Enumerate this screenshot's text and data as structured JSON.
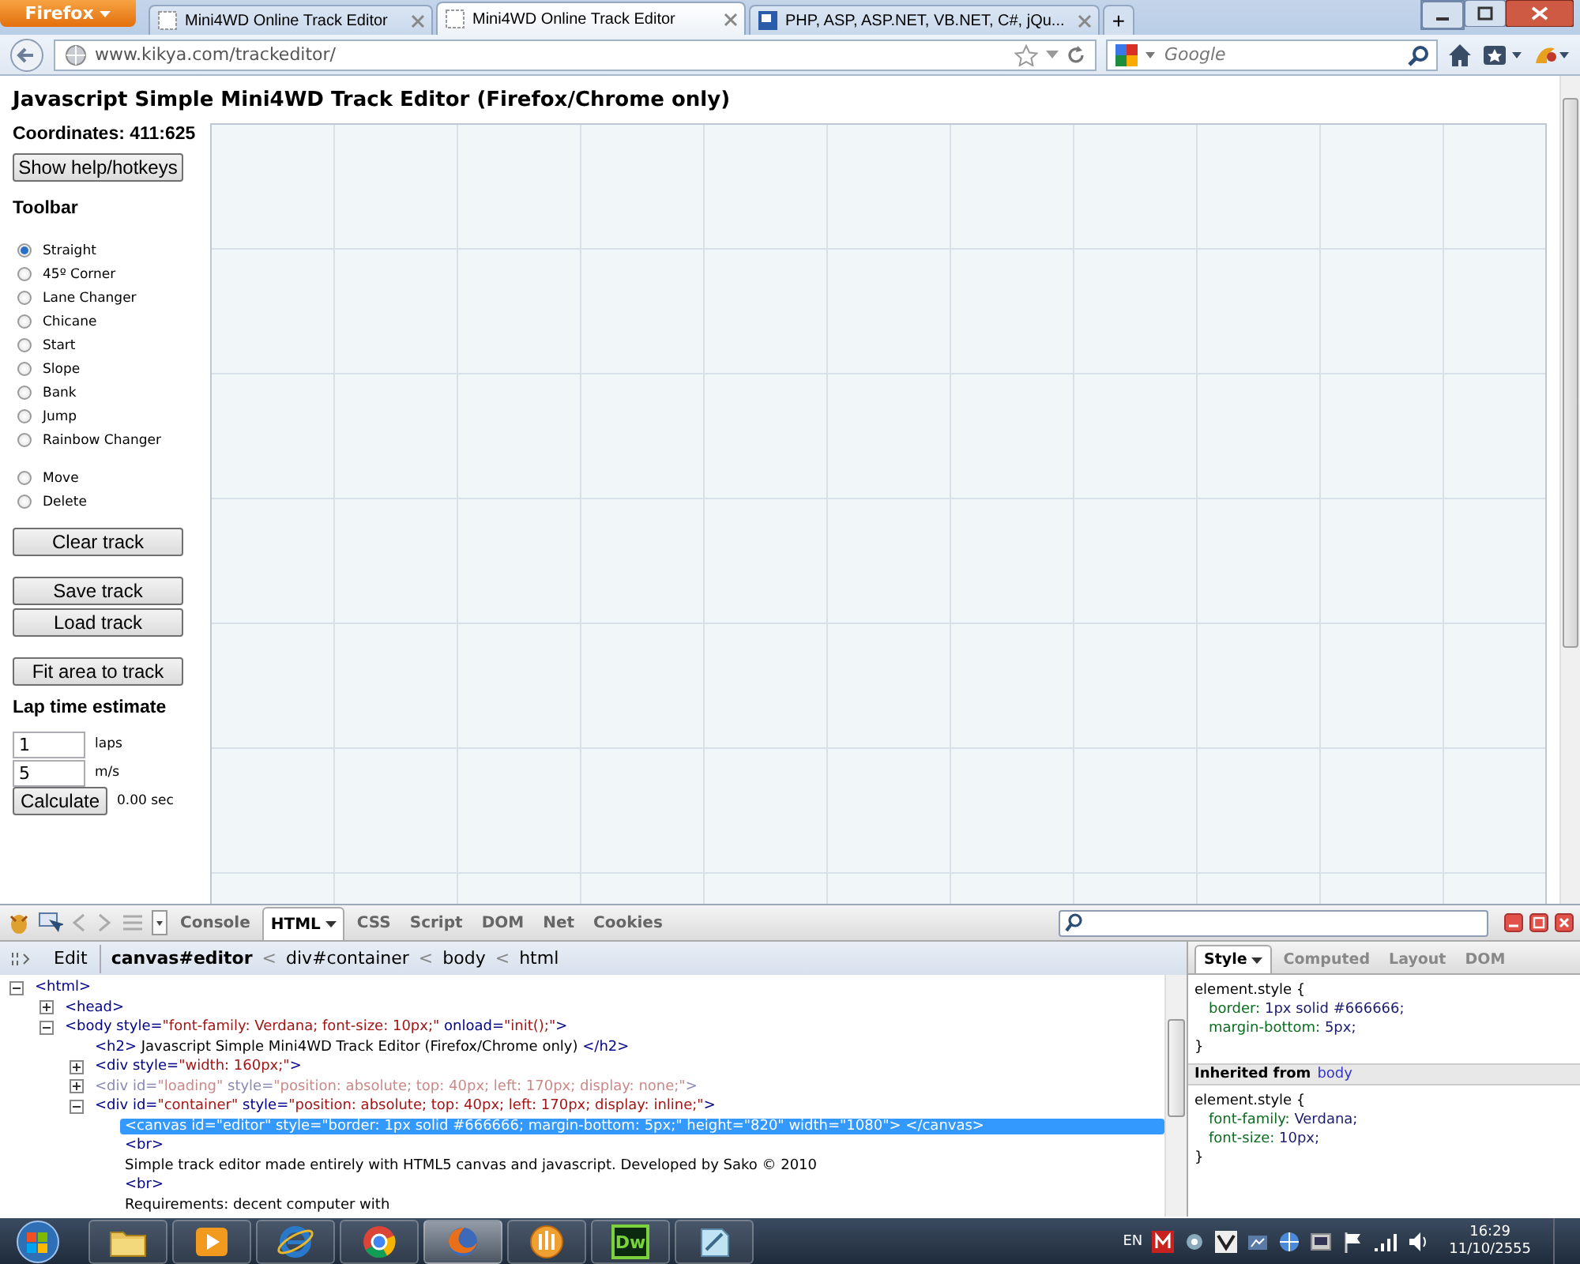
{
  "browser": {
    "menu_button": "Firefox",
    "tabs": [
      {
        "title": "Mini4WD Online Track Editor",
        "selected": false
      },
      {
        "title": "Mini4WD Online Track Editor",
        "selected": true
      },
      {
        "title": "PHP, ASP, ASP.NET, VB.NET, C#, jQu...",
        "selected": false
      }
    ],
    "new_tab": "+",
    "url": "www.kikya.com/trackeditor/",
    "search_placeholder": "Google"
  },
  "page": {
    "title": "Javascript Simple Mini4WD Track Editor (Firefox/Chrome only)",
    "coordinates": "Coordinates: 411:625",
    "help_button": "Show help/hotkeys",
    "toolbar_heading": "Toolbar",
    "tool_groups": [
      {
        "tools": [
          {
            "label": "Straight",
            "selected": true
          },
          {
            "label": "45º Corner",
            "selected": false
          },
          {
            "label": "Lane Changer",
            "selected": false
          },
          {
            "label": "Chicane",
            "selected": false
          },
          {
            "label": "Start",
            "selected": false
          },
          {
            "label": "Slope",
            "selected": false
          },
          {
            "label": "Bank",
            "selected": false
          },
          {
            "label": "Jump",
            "selected": false
          },
          {
            "label": "Rainbow Changer",
            "selected": false
          }
        ]
      },
      {
        "tools": [
          {
            "label": "Move",
            "selected": false
          },
          {
            "label": "Delete",
            "selected": false
          }
        ]
      }
    ],
    "clear_button": "Clear track",
    "save_button": "Save track",
    "load_button": "Load track",
    "fit_button": "Fit area to track",
    "lap_heading": "Lap time estimate",
    "laps": {
      "value": "1",
      "unit": "laps"
    },
    "speed": {
      "value": "5",
      "unit": "m/s"
    },
    "calculate_button": "Calculate",
    "result": "0.00 sec"
  },
  "firebug": {
    "panels": [
      {
        "label": "Console",
        "selected": false,
        "dropdown": false
      },
      {
        "label": "HTML",
        "selected": true,
        "dropdown": true
      },
      {
        "label": "CSS",
        "selected": false,
        "dropdown": false
      },
      {
        "label": "Script",
        "selected": false,
        "dropdown": false
      },
      {
        "label": "DOM",
        "selected": false,
        "dropdown": false
      },
      {
        "label": "Net",
        "selected": false,
        "dropdown": false
      },
      {
        "label": "Cookies",
        "selected": false,
        "dropdown": false
      }
    ],
    "breadcrumb": {
      "edit": "Edit",
      "separator": "<",
      "items": [
        {
          "label": "canvas#editor",
          "selected": true
        },
        {
          "label": "div#container",
          "selected": false
        },
        {
          "label": "body",
          "selected": false
        },
        {
          "label": "html",
          "selected": false
        }
      ]
    },
    "tree": [
      {
        "kind": "element",
        "text": "<html>",
        "expanded": true,
        "selected": false,
        "hidden": false,
        "children": [
          {
            "kind": "element",
            "text": "<head>",
            "expanded": false,
            "selected": false,
            "hidden": false
          },
          {
            "kind": "element",
            "text": "<body style=\"font-family: Verdana; font-size: 10px;\" onload=\"init();\">",
            "expanded": true,
            "selected": false,
            "hidden": false,
            "children": [
              {
                "kind": "element",
                "text": "<h2> Javascript Simple Mini4WD Track Editor (Firefox/Chrome only) </h2>",
                "selected": false,
                "hidden": false
              },
              {
                "kind": "element",
                "text": "<div style=\"width: 160px;\">",
                "expanded": false,
                "selected": false,
                "hidden": false
              },
              {
                "kind": "element",
                "text": "<div id=\"loading\" style=\"position: absolute; top: 40px; left: 170px; display: none;\">",
                "expanded": false,
                "selected": false,
                "hidden": true
              },
              {
                "kind": "element",
                "text": "<div id=\"container\" style=\"position: absolute; top: 40px; left: 170px; display: inline;\">",
                "expanded": true,
                "selected": false,
                "hidden": false,
                "children": [
                  {
                    "kind": "element",
                    "text": "<canvas id=\"editor\" style=\"border: 1px solid #666666; margin-bottom: 5px;\" height=\"820\" width=\"1080\"> </canvas>",
                    "selected": true,
                    "hidden": false
                  },
                  {
                    "kind": "element",
                    "text": "<br>",
                    "selected": false,
                    "hidden": false
                  },
                  {
                    "kind": "text",
                    "text": "Simple track editor made entirely with HTML5 canvas and javascript. Developed by Sako © 2010",
                    "selected": false,
                    "hidden": false
                  },
                  {
                    "kind": "element",
                    "text": "<br>",
                    "selected": false,
                    "hidden": false
                  },
                  {
                    "kind": "text",
                    "text": "Requirements: decent computer with",
                    "selected": false,
                    "hidden": false
                  }
                ]
              }
            ]
          }
        ]
      }
    ],
    "side_tabs": [
      {
        "label": "Style",
        "selected": true,
        "dropdown": true
      },
      {
        "label": "Computed",
        "selected": false,
        "dropdown": false
      },
      {
        "label": "Layout",
        "selected": false,
        "dropdown": false
      },
      {
        "label": "DOM",
        "selected": false,
        "dropdown": false
      }
    ],
    "rules": [
      {
        "selector": "element.style {",
        "close": "}",
        "declarations": [
          {
            "property": "border:",
            "value": "1px solid #666666;"
          },
          {
            "property": "margin-bottom:",
            "value": "5px;"
          }
        ]
      }
    ],
    "inherited_heading": {
      "label": "Inherited from",
      "link": "body"
    },
    "inherited_rules": [
      {
        "selector": "element.style {",
        "close": "}",
        "declarations": [
          {
            "property": "font-family:",
            "value": "Verdana;"
          },
          {
            "property": "font-size:",
            "value": "10px;"
          }
        ]
      }
    ]
  },
  "taskbar": {
    "apps": [
      {
        "kind": "folder",
        "active": false
      },
      {
        "kind": "media",
        "active": false
      },
      {
        "kind": "ie",
        "active": false
      },
      {
        "kind": "chrome",
        "active": false
      },
      {
        "kind": "firefox",
        "active": true
      },
      {
        "kind": "orange",
        "active": false
      },
      {
        "kind": "dw",
        "label": "Dw",
        "active": false
      },
      {
        "kind": "notepad",
        "active": false
      }
    ],
    "language": "EN",
    "time": "16:29",
    "date": "11/10/2555"
  }
}
